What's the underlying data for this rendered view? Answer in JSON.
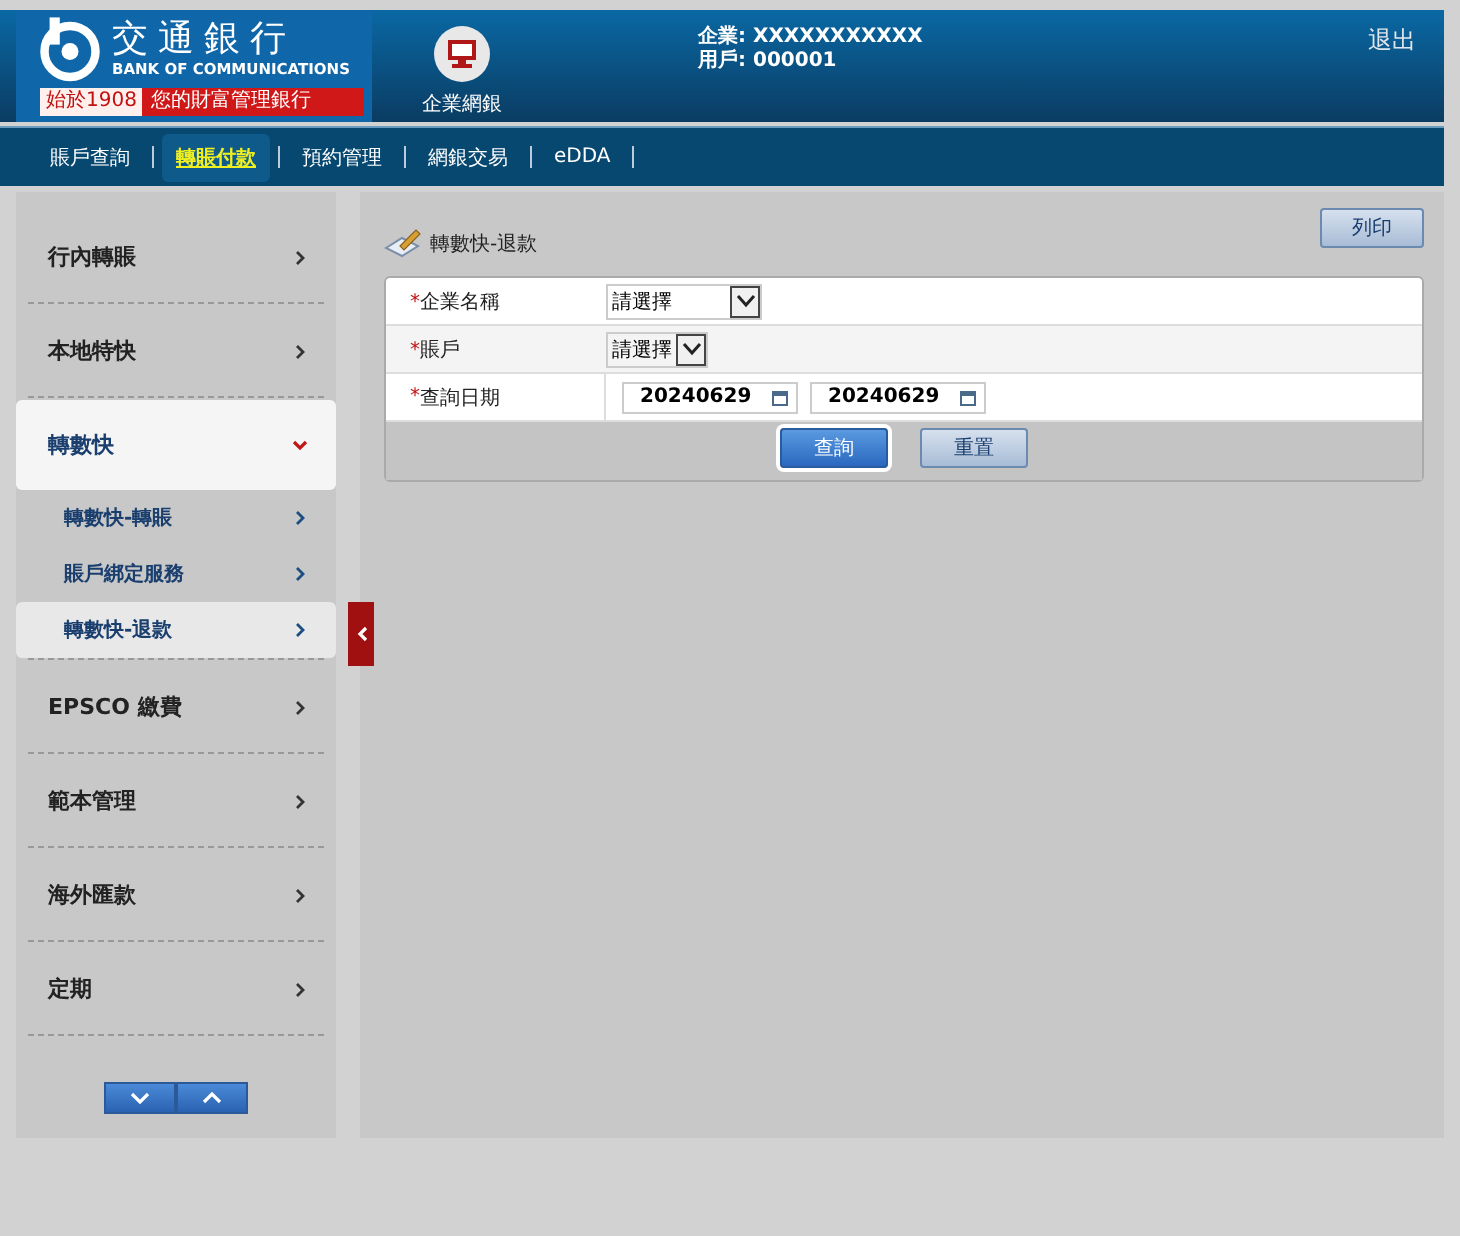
{
  "header": {
    "bank_name": "交通銀行",
    "bank_name_en": "BANK OF COMMUNICATIONS",
    "since": "始於1908",
    "slogan": "您的財富管理銀行",
    "service_label": "企業網銀",
    "company": "企業: XXXXXXXXXXX",
    "user": "用戶: 000001",
    "logout": "退出"
  },
  "nav": [
    {
      "label": "賬戶查詢",
      "selected": false
    },
    {
      "label": "轉賬付款",
      "selected": true
    },
    {
      "label": "預約管理",
      "selected": false
    },
    {
      "label": "網銀交易",
      "selected": false
    },
    {
      "label": "eDDA",
      "selected": false
    }
  ],
  "sidebar": {
    "items": [
      {
        "label": "行內轉賬",
        "expanded": false
      },
      {
        "label": "本地特快",
        "expanded": false
      },
      {
        "label": "轉數快",
        "expanded": true,
        "children": [
          {
            "label": "轉數快-轉賬",
            "selected": false
          },
          {
            "label": "賬戶綁定服務",
            "selected": false
          },
          {
            "label": "轉數快-退款",
            "selected": true
          }
        ]
      },
      {
        "label": "EPSCO 繳費",
        "expanded": false
      },
      {
        "label": "範本管理",
        "expanded": false
      },
      {
        "label": "海外匯款",
        "expanded": false
      },
      {
        "label": "定期",
        "expanded": false
      }
    ]
  },
  "page": {
    "title": "轉數快-退款",
    "print_button": "列印"
  },
  "form": {
    "fields": [
      {
        "kind": "select",
        "required_mark": "*",
        "label": "企業名稱",
        "value": "請選擇"
      },
      {
        "kind": "select-narrow",
        "required_mark": "*",
        "label": "賬戶",
        "value": "請選擇"
      },
      {
        "kind": "date-range",
        "required_mark": "*",
        "label": "查詢日期",
        "from": "20240629",
        "to": "20240629"
      }
    ],
    "buttons": [
      {
        "label": "查詢",
        "primary": true
      },
      {
        "label": "重置",
        "primary": false
      }
    ]
  }
}
